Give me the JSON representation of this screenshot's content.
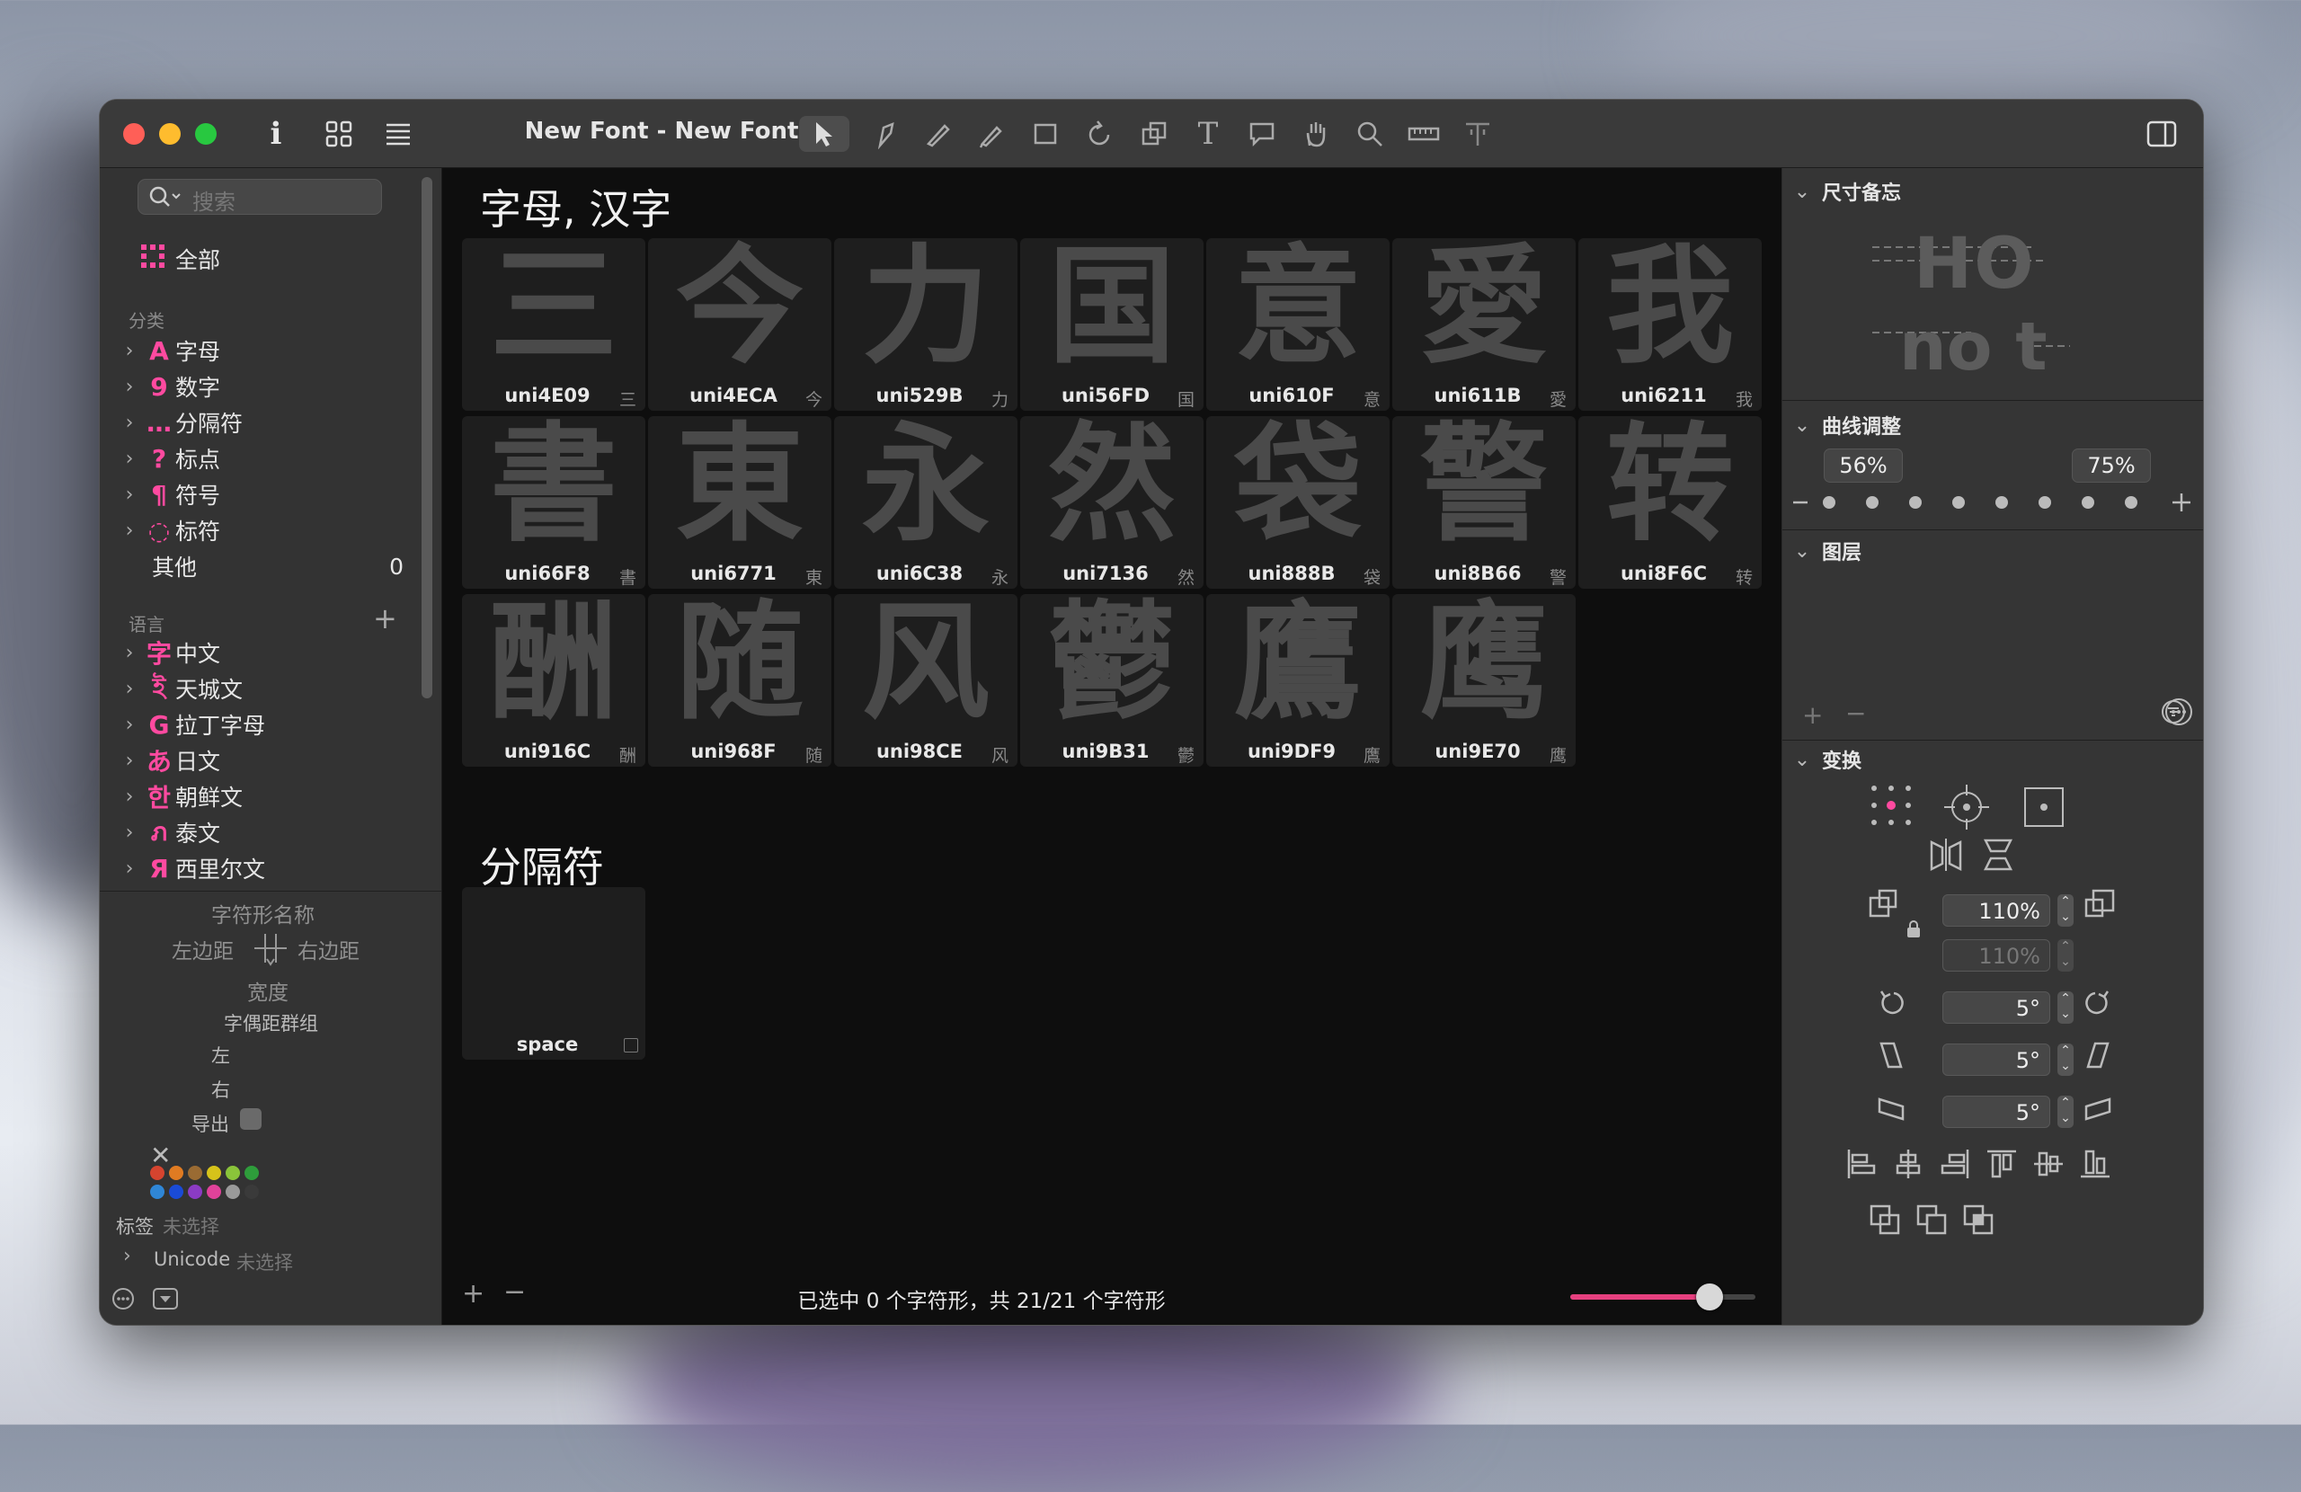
{
  "window": {
    "title": "New Font - New Font"
  },
  "search": {
    "placeholder": "搜索"
  },
  "sidebar": {
    "all_label": "全部",
    "category_header": "分类",
    "categories": [
      {
        "icon": "A",
        "label": "字母"
      },
      {
        "icon": "9",
        "label": "数字"
      },
      {
        "icon": "…",
        "label": "分隔符"
      },
      {
        "icon": "?",
        "label": "标点"
      },
      {
        "icon": "¶",
        "label": "符号"
      },
      {
        "icon": "◌",
        "label": "标符"
      }
    ],
    "other_label": "其他",
    "other_count": "0",
    "language_header": "语言",
    "languages": [
      {
        "icon": "字",
        "label": "中文"
      },
      {
        "icon": "ই",
        "label": "天城文"
      },
      {
        "icon": "G",
        "label": "拉丁字母"
      },
      {
        "icon": "あ",
        "label": "日文"
      },
      {
        "icon": "한",
        "label": "朝鲜文"
      },
      {
        "icon": "ภ",
        "label": "泰文"
      },
      {
        "icon": "Я",
        "label": "西里尔文"
      }
    ],
    "glyph_name_label": "字符形名称",
    "left_sb_label": "左边距",
    "right_sb_label": "右边距",
    "width_label": "宽度",
    "kerning_group_label": "字偶距群组",
    "left_label": "左",
    "right_label": "右",
    "export_label": "导出",
    "tag_label": "标签",
    "tag_value": "未选择",
    "unicode_label": "Unicode",
    "unicode_value": "未选择",
    "colors": [
      "#d6442f",
      "#e07b22",
      "#9a6b33",
      "#d6c31a",
      "#8ac43a",
      "#2e9d3b",
      "#2f86d6",
      "#1a4bd6",
      "#8b3bc4",
      "#e0429a",
      "#9a9a9a",
      "#3a3a3a"
    ]
  },
  "main": {
    "section1_title": "字母, 汉字",
    "glyphs": [
      {
        "char": "三",
        "name": "uni4E09"
      },
      {
        "char": "今",
        "name": "uni4ECA"
      },
      {
        "char": "力",
        "name": "uni529B"
      },
      {
        "char": "国",
        "name": "uni56FD"
      },
      {
        "char": "意",
        "name": "uni610F"
      },
      {
        "char": "愛",
        "name": "uni611B"
      },
      {
        "char": "我",
        "name": "uni6211"
      },
      {
        "char": "書",
        "name": "uni66F8"
      },
      {
        "char": "東",
        "name": "uni6771"
      },
      {
        "char": "永",
        "name": "uni6C38"
      },
      {
        "char": "然",
        "name": "uni7136"
      },
      {
        "char": "袋",
        "name": "uni888B"
      },
      {
        "char": "警",
        "name": "uni8B66"
      },
      {
        "char": "转",
        "name": "uni8F6C"
      },
      {
        "char": "酬",
        "name": "uni916C"
      },
      {
        "char": "随",
        "name": "uni968F"
      },
      {
        "char": "风",
        "name": "uni98CE"
      },
      {
        "char": "鬱",
        "name": "uni9B31"
      },
      {
        "char": "鷹",
        "name": "uni9DF9"
      },
      {
        "char": "鹰",
        "name": "uni9E70"
      }
    ],
    "section2_title": "分隔符",
    "space_glyph": {
      "char": "",
      "name": "space"
    },
    "status": "已选中 0 个字符形，共 21/21 个字符形",
    "zoom_fraction": 0.75
  },
  "inspector": {
    "dimensions_title": "尺寸备忘",
    "preview_line1": "HO",
    "preview_line2": "no t",
    "curve_title": "曲线调整",
    "curve_left": "56%",
    "curve_right": "75%",
    "layers_title": "图层",
    "transform_title": "变换",
    "scale_x": "110%",
    "scale_y": "110%",
    "rotate": "5°",
    "slant": "5°",
    "skew": "5°"
  }
}
